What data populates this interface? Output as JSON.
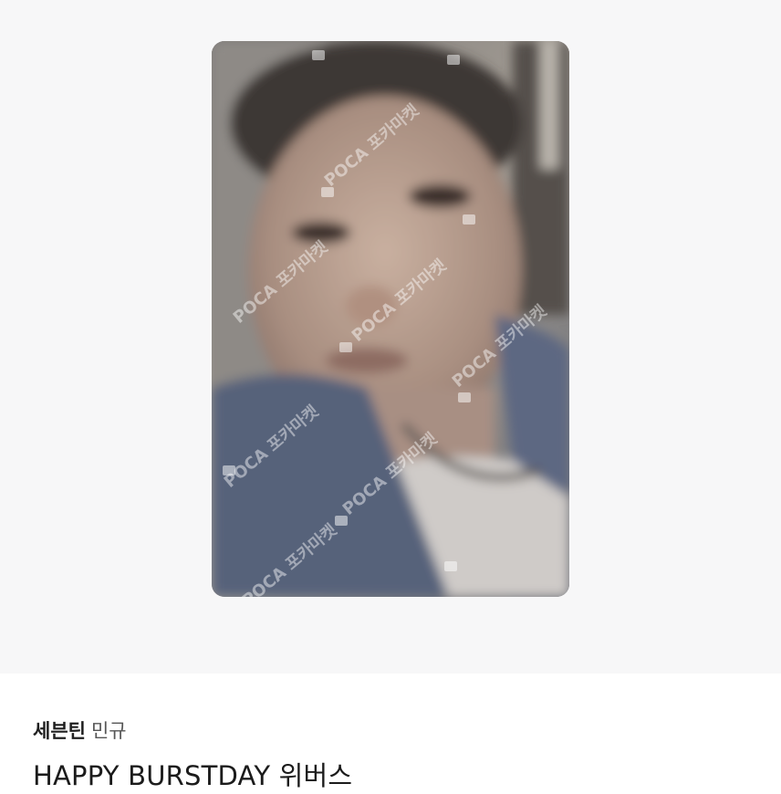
{
  "product": {
    "group": "세븐틴",
    "member": "민규",
    "title": "HAPPY BURSTDAY 위버스"
  },
  "photo": {
    "watermark": "POCA 포카마켓",
    "icon": "photo-placeholder-icon"
  }
}
